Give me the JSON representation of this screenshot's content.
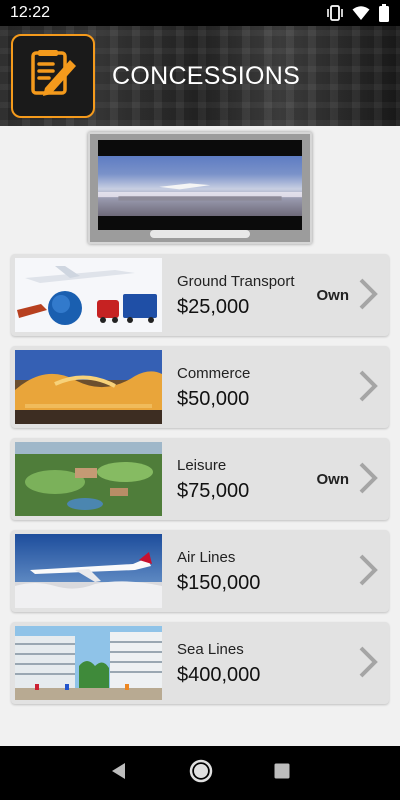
{
  "status_bar": {
    "time": "12:22",
    "icons": [
      "vibrate-icon",
      "wifi-icon",
      "battery-icon"
    ]
  },
  "header": {
    "title": "CONCESSIONS",
    "logo_icon": "edit-document-icon",
    "accent_color": "#f49a1c"
  },
  "concessions": [
    {
      "name": "Ground Transport",
      "price": "$25,000",
      "status": "Own",
      "image": "transport-vehicles-globe"
    },
    {
      "name": "Commerce",
      "price": "$50,000",
      "status": "",
      "image": "airport-terminal-building"
    },
    {
      "name": "Leisure",
      "price": "$75,000",
      "status": "Own",
      "image": "golf-resort-aerial"
    },
    {
      "name": "Air Lines",
      "price": "$150,000",
      "status": "",
      "image": "airliner-in-flight"
    },
    {
      "name": "Sea Lines",
      "price": "$400,000",
      "status": "",
      "image": "cruise-ships-port"
    }
  ],
  "nav": {
    "back": "back-icon",
    "home": "home-icon",
    "recents": "recents-icon"
  }
}
